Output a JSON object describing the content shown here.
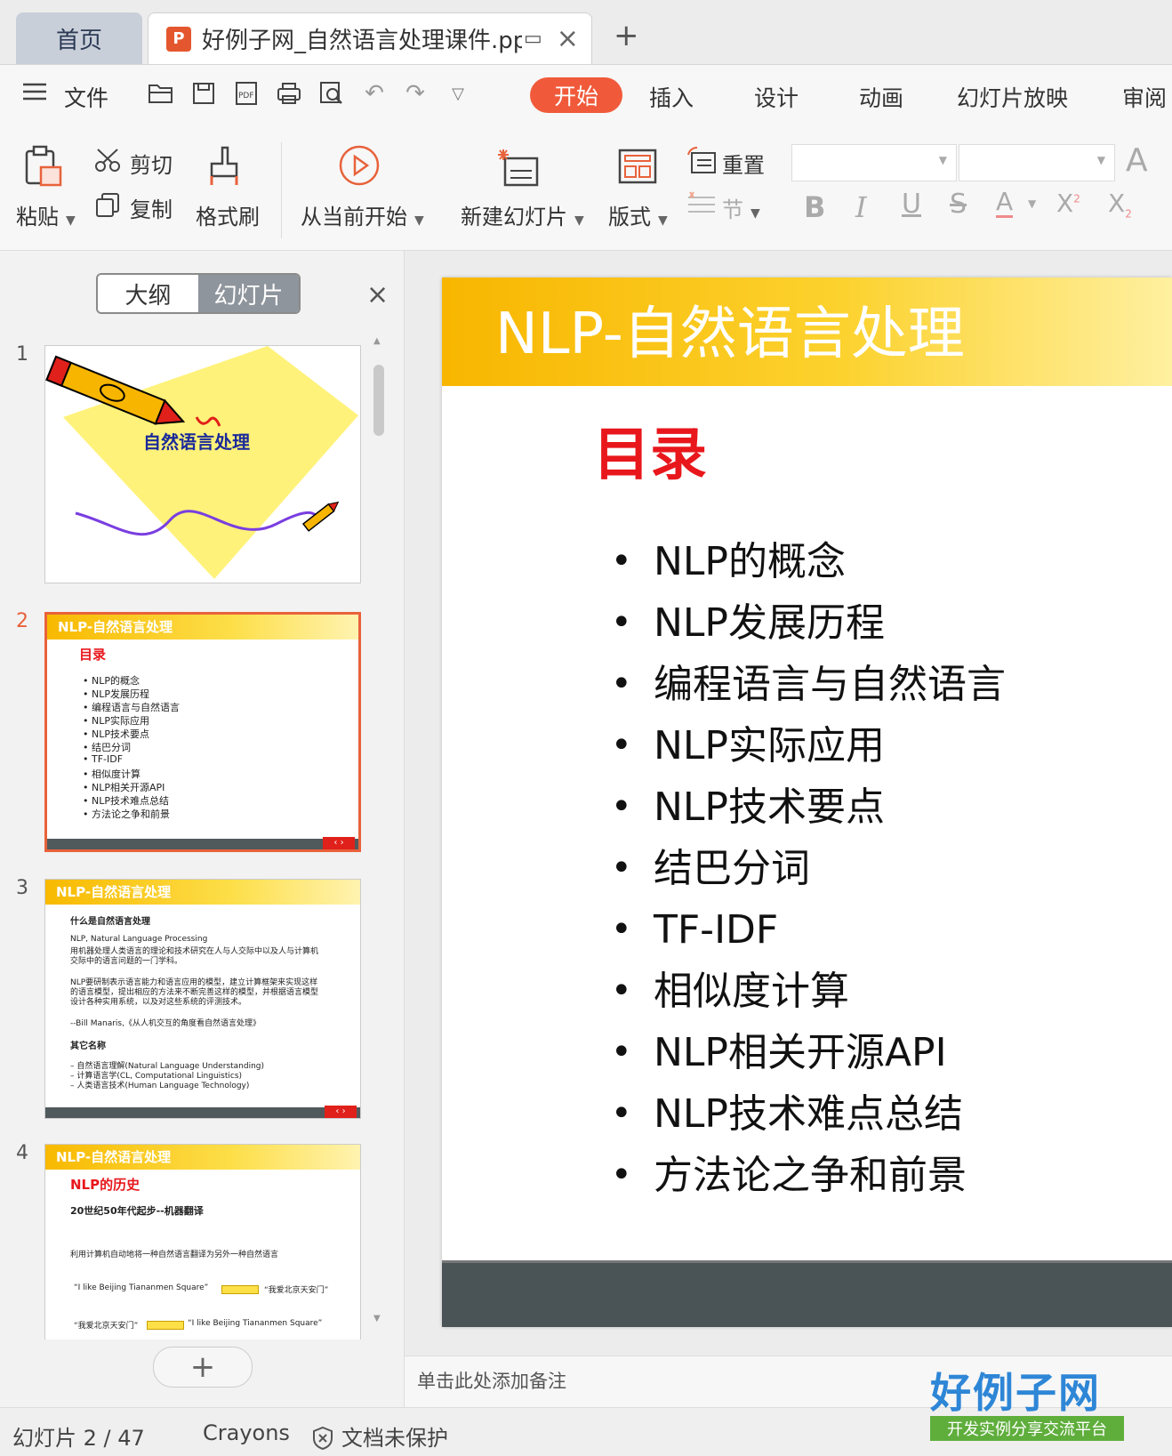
{
  "tabs": {
    "home": "首页",
    "document": "好例子网_自然语言处理课件.ppt",
    "new_tab": "+"
  },
  "menu": {
    "file": "文件",
    "items": [
      "开始",
      "插入",
      "设计",
      "动画",
      "幻灯片放映",
      "审阅"
    ]
  },
  "ribbon": {
    "paste": "粘贴",
    "cut": "剪切",
    "copy": "复制",
    "format_painter": "格式刷",
    "play_from_current": "从当前开始",
    "new_slide": "新建幻灯片",
    "layout": "版式",
    "reset": "重置",
    "section": "节"
  },
  "panel": {
    "outline": "大纲",
    "slides": "幻灯片",
    "close": "×",
    "add": "+"
  },
  "thumbs": {
    "t1_title": "自然语言处理",
    "bar_title": "NLP-自然语言处理",
    "t2_heading": "目录",
    "t2_items": [
      "NLP的概念",
      "NLP发展历程",
      "编程语言与自然语言",
      "NLP实际应用",
      "NLP技术要点",
      "结巴分词",
      "TF-IDF",
      "相似度计算",
      "NLP相关开源API",
      "NLP技术难点总结",
      "方法论之争和前景"
    ],
    "t3_lines": [
      "什么是自然语言处理",
      "NLP, Natural Language Processing",
      "用机器处理人类语言的理论和技术研究在人与人交际中以及人与计算机",
      "交际中的语言问题的一门学科。",
      "NLP要研制表示语言能力和语言应用的模型，建立计算框架来实现这样",
      "的语言模型，提出相应的方法来不断完善这样的模型，并根据语言模型",
      "设计各种实用系统，以及对这些系统的评测技术。",
      "--Bill Manaris,《从人机交互的角度看自然语言处理》",
      "其它名称",
      "–   自然语言理解(Natural Language Understanding)",
      "–   计算语言学(CL, Computational Linguistics)",
      "–   人类语言技术(Human Language Technology)"
    ],
    "t4_heading": "NLP的历史",
    "t4_sub": "20世纪50年代起步--机器翻译",
    "t4_desc": "利用计算机自动地将一种自然语言翻译为另外一种自然语言",
    "t4_ex1a": "“I like Beijing Tiananmen Square”",
    "t4_ex1b": "“我爱北京天安门”",
    "t4_ex2a": "“我爱北京天安门”",
    "t4_ex2b": "“I like Beijing Tiananmen Square”",
    "nav": "‹ ›"
  },
  "slide": {
    "title": "NLP-自然语言处理",
    "heading": "目录",
    "items": [
      "NLP的概念",
      "NLP发展历程",
      "编程语言与自然语言",
      "NLP实际应用",
      "NLP技术要点",
      "结巴分词",
      "TF-IDF",
      "相似度计算",
      "NLP相关开源API",
      "NLP技术难点总结",
      "方法论之争和前景"
    ]
  },
  "notes_placeholder": "单击此处添加备注",
  "status": {
    "slide_counter": "幻灯片 2 / 47",
    "theme": "Crayons",
    "protection": "文档未保护"
  },
  "watermark": {
    "logo": "好例子网",
    "tagline": "开发实例分享交流平台"
  },
  "colors": {
    "accent": "#f05a3a",
    "title_bar": "#f8b600",
    "heading_red": "#e8171c",
    "footer": "#4a5355"
  }
}
